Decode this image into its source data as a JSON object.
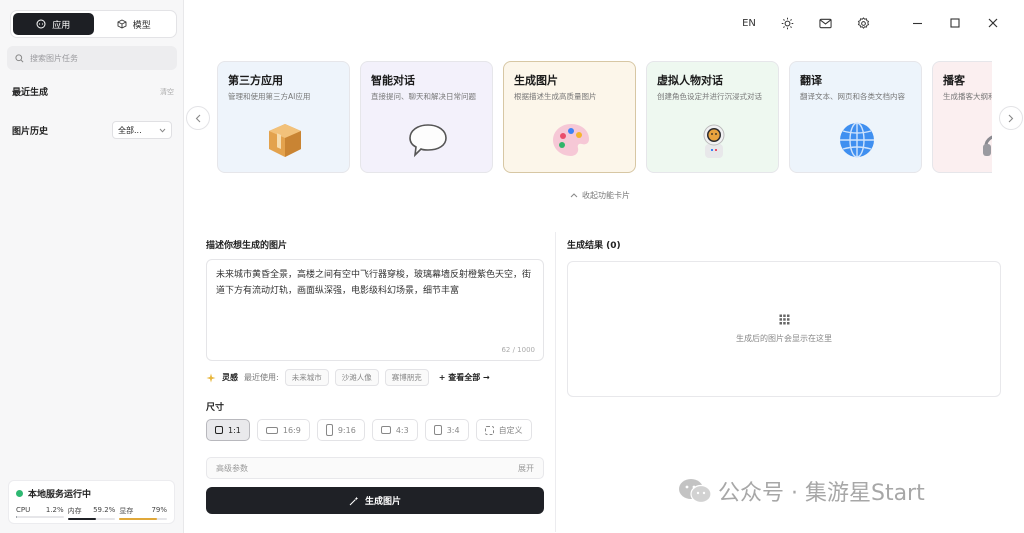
{
  "sidebar": {
    "tabs": [
      {
        "label": "应用",
        "active": true,
        "icon": "chat-bubble-icon"
      },
      {
        "label": "模型",
        "active": false,
        "icon": "cube-icon"
      }
    ],
    "search_placeholder": "搜索图片任务",
    "recent": {
      "title": "最近生成",
      "action": "清空"
    },
    "history": {
      "title": "图片历史",
      "filter": "全部..."
    },
    "status": {
      "title": "本地服务运行中",
      "metrics": [
        {
          "label": "CPU",
          "value": "1.2%",
          "fraction": 0.012,
          "color": "#9aa0a6"
        },
        {
          "label": "内存",
          "value": "59.2%",
          "fraction": 0.592,
          "color": "#1f2126"
        },
        {
          "label": "显存",
          "value": "79%",
          "fraction": 0.79,
          "color": "#e0a83a"
        }
      ]
    }
  },
  "topbar": {
    "lang": "EN"
  },
  "cards": [
    {
      "title": "第三方应用",
      "desc": "管理和使用第三方AI应用",
      "bg": "#eef4fb",
      "icon": "box-icon",
      "selected": false
    },
    {
      "title": "智能对话",
      "desc": "直接提问、聊天和解决日常问题",
      "bg": "#f3f1fb",
      "icon": "speech-bubble-icon",
      "selected": false
    },
    {
      "title": "生成图片",
      "desc": "根据描述生成高质量图片",
      "bg": "#fcf6ea",
      "icon": "palette-icon",
      "selected": true
    },
    {
      "title": "虚拟人物对话",
      "desc": "创建角色设定并进行沉浸式对话",
      "bg": "#eef8f0",
      "icon": "astronaut-icon",
      "selected": false
    },
    {
      "title": "翻译",
      "desc": "翻译文本、网页和各类文档内容",
      "bg": "#edf4fb",
      "icon": "globe-icon",
      "selected": false
    },
    {
      "title": "播客",
      "desc": "生成播客大纲和主动问题",
      "bg": "#fbeff0",
      "icon": "headphones-icon",
      "selected": false
    }
  ],
  "collapse_label": "收起功能卡片",
  "form": {
    "prompt_label": "描述你想生成的图片",
    "prompt_text": "未来城市黄昏全景，高楼之间有空中飞行器穿梭，玻璃幕墙反射橙紫色天空，街道下方有流动灯轨，画面纵深强，电影级科幻场景，细节丰富",
    "count": "62 / 1000",
    "inspiration": {
      "lead": "灵感",
      "recent_label": "最近使用:",
      "chips": [
        "未来城市",
        "沙滩人像",
        "赛博朋克"
      ],
      "view_all": "+ 查看全部 →"
    },
    "size_label": "尺寸",
    "sizes": [
      {
        "label": "1:1",
        "active": true,
        "w": 8,
        "h": 8
      },
      {
        "label": "16:9",
        "active": false,
        "w": 12,
        "h": 7
      },
      {
        "label": "9:16",
        "active": false,
        "w": 7,
        "h": 12
      },
      {
        "label": "4:3",
        "active": false,
        "w": 10,
        "h": 8
      },
      {
        "label": "3:4",
        "active": false,
        "w": 8,
        "h": 10
      },
      {
        "label": "自定义",
        "active": false,
        "w": 9,
        "h": 9
      }
    ],
    "advanced_label": "高级参数",
    "advanced_action": "展开",
    "generate_label": "生成图片"
  },
  "results": {
    "title": "生成结果 (0)",
    "empty_text": "生成后的图片会显示在这里"
  },
  "watermark": "公众号 · 集游星Start"
}
